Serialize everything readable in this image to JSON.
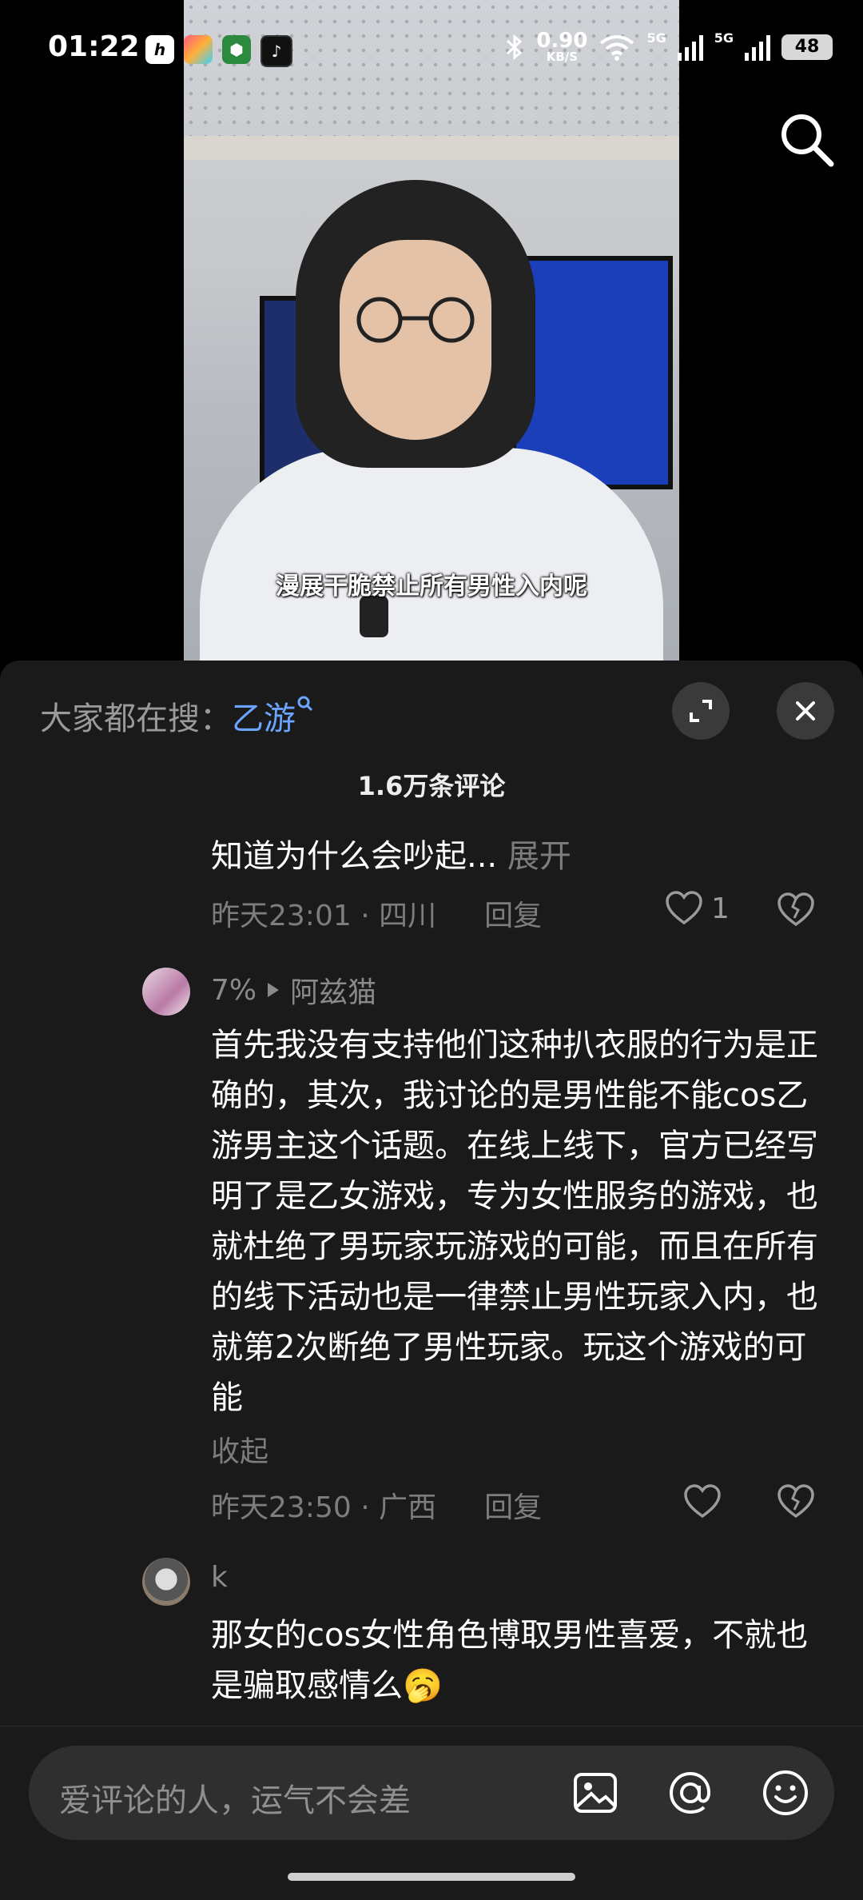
{
  "status_bar": {
    "time": "01:22",
    "net_speed_value": "0.90",
    "net_speed_unit": "KB/S",
    "sim1": "5G",
    "sim2": "5G",
    "battery": "48"
  },
  "video": {
    "subtitle": "漫展干脆禁止所有男性入内呢"
  },
  "sheet": {
    "trending_label": "大家都在搜：",
    "trending_term": "乙游",
    "comment_count": "1.6万条评论"
  },
  "comments": [
    {
      "text": "知道为什么会吵起...",
      "expand_label": "展开",
      "time": "昨天23:01 · 四川",
      "reply_label": "回复",
      "likes": "1"
    },
    {
      "author_tag": "7%",
      "author": "阿兹猫",
      "text": "首先我没有支持他们这种扒衣服的行为是正确的，其次，我讨论的是男性能不能cos乙游男主这个话题。在线上线下，官方已经写明了是乙女游戏，专为女性服务的游戏，也就杜绝了男玩家玩游戏的可能，而且在所有的线下活动也是一律禁止男性玩家入内，也就第2次断绝了男性玩家。玩这个游戏的可能",
      "collapse_label": "收起",
      "time": "昨天23:50 · 广西",
      "reply_label": "回复",
      "likes": ""
    },
    {
      "author": "k",
      "text": "那女的cos女性角色博取男性喜爱，不就也是骗取感情么",
      "emoji": "🥱"
    }
  ],
  "input": {
    "placeholder": "爱评论的人，运气不会差"
  },
  "colors": {
    "accent": "#6aa6ff",
    "sheet_bg": "#1a1a1a"
  }
}
